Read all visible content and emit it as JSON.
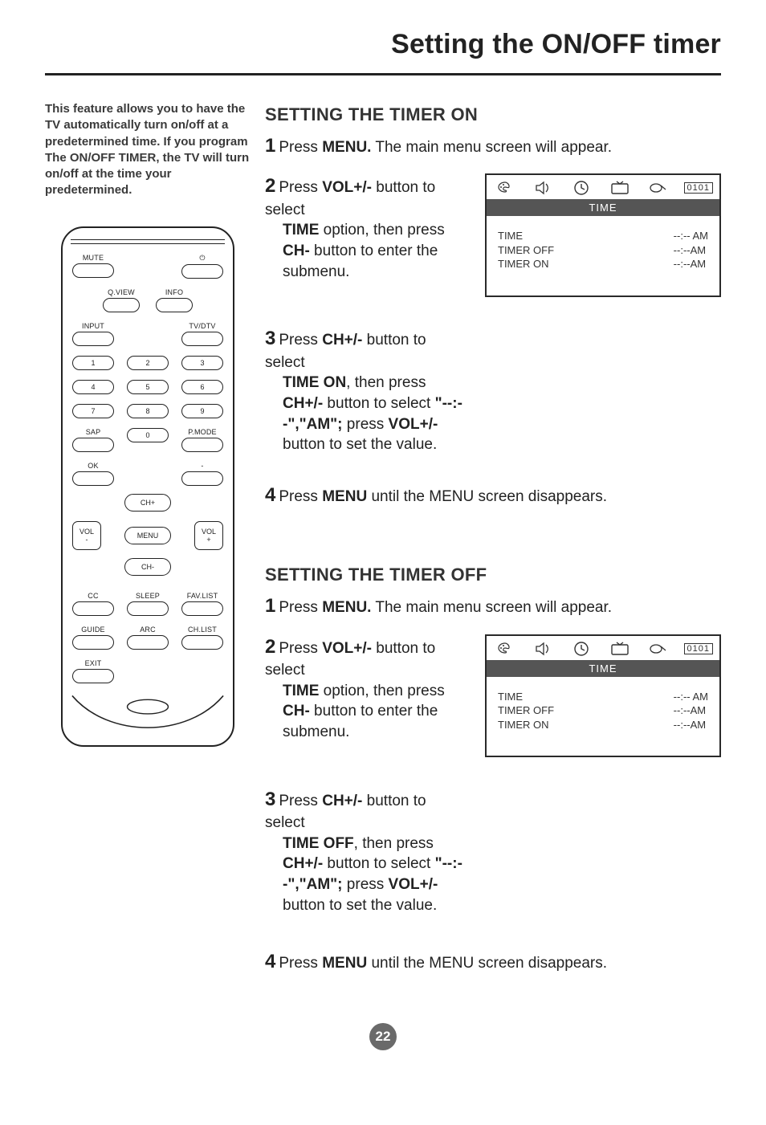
{
  "page_title": "Setting the ON/OFF timer",
  "page_number": "22",
  "intro": "This feature allows you to have the TV automatically turn on/off at a predetermined time. If you program The ON/OFF TIMER, the TV will turn on/off at the time your predetermined.",
  "sections": {
    "on": {
      "heading": "SETTING THE TIMER ON",
      "steps": {
        "s1_num": "1",
        "s1_a": "Press ",
        "s1_b": "MENU.",
        "s1_c": " The main menu screen will appear.",
        "s2_num": "2",
        "s2_a": "Press ",
        "s2_b": "VOL+/-",
        "s2_c": " button to select ",
        "s2_d": "TIME",
        "s2_e": " option, then press ",
        "s2_f": "CH-",
        "s2_g": " button to enter the submenu.",
        "s3_num": "3",
        "s3_a": "Press ",
        "s3_b": "CH+/-",
        "s3_c": " button to select ",
        "s3_d": "TIME ON",
        "s3_e": ", then press ",
        "s3_f": "CH+/-",
        "s3_g": " button to select ",
        "s3_h": "\"--:--\",\"AM\";",
        "s3_i": " press ",
        "s3_j": "VOL+/-",
        "s3_k": " button to set the value.",
        "s4_num": "4",
        "s4_a": "Press ",
        "s4_b": "MENU",
        "s4_c": " until the MENU screen disappears."
      }
    },
    "off": {
      "heading": "SETTING THE TIMER OFF",
      "steps": {
        "s1_num": "1",
        "s1_a": "Press ",
        "s1_b": "MENU.",
        "s1_c": " The main menu screen will appear.",
        "s2_num": "2",
        "s2_a": "Press ",
        "s2_b": "VOL+/-",
        "s2_c": " button to select ",
        "s2_d": "TIME",
        "s2_e": " option, then press ",
        "s2_f": "CH-",
        "s2_g": " button to enter the submenu.",
        "s3_num": "3",
        "s3_a": "Press ",
        "s3_b": "CH+/-",
        "s3_c": " button to select ",
        "s3_d": "TIME OFF",
        "s3_e": ", then press ",
        "s3_f": "CH+/-",
        "s3_g": " button to select ",
        "s3_h": "\"--:--\",\"AM\";",
        "s3_i": " press ",
        "s3_j": "VOL+/-",
        "s3_k": " button to set the value.",
        "s4_num": "4",
        "s4_a": "Press ",
        "s4_b": "MENU",
        "s4_c": " until the MENU screen disappears."
      }
    }
  },
  "osd": {
    "code": "0101",
    "band": "TIME",
    "left": "TIME\nTIMER OFF\nTIMER ON",
    "right": "--:-- AM\n--:--AM\n--:--AM"
  },
  "remote": {
    "top": {
      "mute": "MUTE",
      "power": "⏻",
      "qview": "Q.VIEW",
      "info": "INFO",
      "input": "INPUT",
      "tvdtv": "TV/DTV"
    },
    "digits": {
      "d1": "1",
      "d2": "2",
      "d3": "3",
      "d4": "4",
      "d5": "5",
      "d6": "6",
      "d7": "7",
      "d8": "8",
      "d9": "9",
      "d0": "0"
    },
    "labels": {
      "sap": "SAP",
      "pmode": "P.MODE",
      "ok": "OK",
      "dash": "-",
      "chp": "CH+",
      "chm": "CH-",
      "volm": "VOL\n-",
      "volp": "VOL\n+",
      "menu": "MENU"
    },
    "bottom": {
      "cc": "CC",
      "sleep": "SLEEP",
      "fav": "FAV.LIST",
      "guide": "GUIDE",
      "arc": "ARC",
      "chlist": "CH.LIST",
      "exit": "EXIT"
    }
  }
}
